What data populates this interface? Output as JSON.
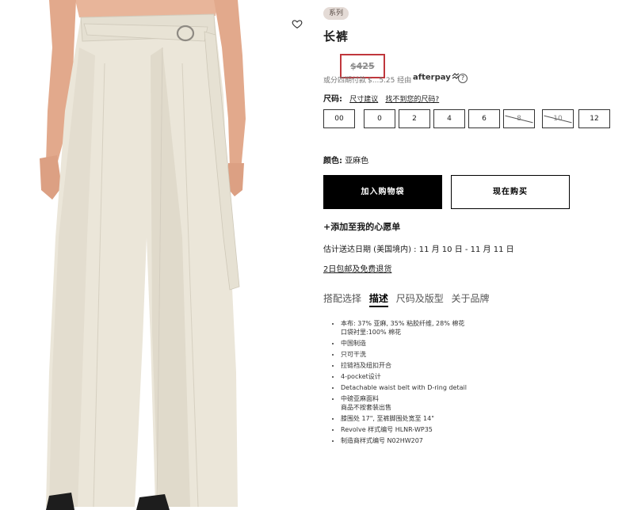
{
  "product": {
    "tag": "系列",
    "title": "长裤",
    "price": "$425",
    "installment_text": "或分四期付款",
    "installment_amount": "$...5.25 经由",
    "afterpay_label": "afterpay",
    "help_glyph": "?"
  },
  "size": {
    "label": "尺码:",
    "link_guide": "尺寸建议",
    "link_missing": "找不到您的尺码?",
    "options": [
      {
        "label": "00",
        "available": true
      },
      {
        "label": "0",
        "available": true
      },
      {
        "label": "2",
        "available": true
      },
      {
        "label": "4",
        "available": true
      },
      {
        "label": "6",
        "available": true
      },
      {
        "label": "8",
        "available": false
      },
      {
        "label": "10",
        "available": false
      },
      {
        "label": "12",
        "available": true
      }
    ]
  },
  "color": {
    "label": "颜色:",
    "value": "亚麻色"
  },
  "actions": {
    "add_to_cart": "加入购物袋",
    "buy_now": "现在购买",
    "wishlist": "+添加至我的心愿单"
  },
  "shipping": {
    "delivery": "估计送达日期 (美国境内) : 11 月 10 日 - 11 月 11 日",
    "returns": "2日包邮及免费退货"
  },
  "tabs": [
    "搭配选择",
    "描述",
    "尺码及版型",
    "关于品牌"
  ],
  "active_tab": "描述",
  "details": [
    {
      "line": "本布: 37% 亚麻, 35% 粘胶纤维, 28% 棉花",
      "sub": "口袋衬里:100% 棉花"
    },
    {
      "line": "中国制造"
    },
    {
      "line": "只可干洗"
    },
    {
      "line": "拉链裆及纽扣开合"
    },
    {
      "line": "4-pocket设计"
    },
    {
      "line": "Detachable waist belt with D-ring detail"
    },
    {
      "line": "中磅亚麻面料",
      "sub": "商品不按套装出售"
    },
    {
      "line": "膝围处 17\", 至裤脚围处宽至 14\""
    },
    {
      "line": "Revolve 样式编号 HLNR-WP35"
    },
    {
      "line": "制造商样式编号 N02HW207"
    }
  ],
  "icons": {
    "heart": "heart-icon",
    "help": "help-circle-icon"
  },
  "colors": {
    "price_box": "#c0373c",
    "tag_bg": "#e4dbd6",
    "cart_bg": "#000000",
    "trouser_fabric": "#e9e4d6"
  }
}
